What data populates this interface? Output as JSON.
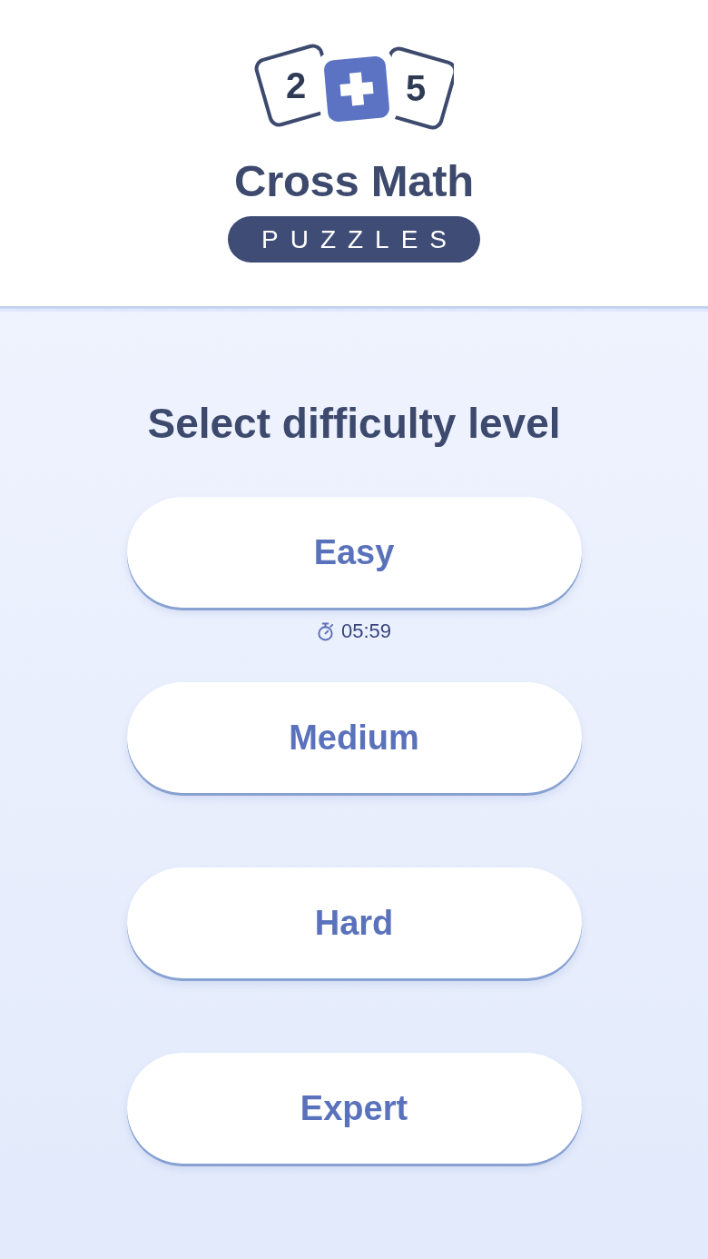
{
  "header": {
    "logo": {
      "left_tile": "2",
      "right_tile": "5"
    },
    "title": "Cross Math",
    "subtitle": "PUZZLES"
  },
  "prompt": "Select difficulty level",
  "levels": [
    {
      "label": "Easy",
      "time": "05:59"
    },
    {
      "label": "Medium"
    },
    {
      "label": "Hard"
    },
    {
      "label": "Expert"
    }
  ]
}
